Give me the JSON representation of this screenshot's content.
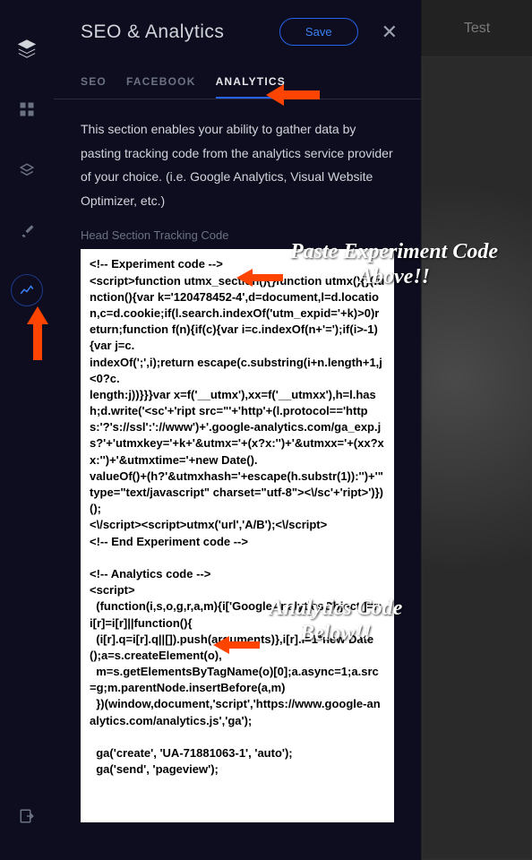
{
  "header": {
    "title": "SEO & Analytics",
    "save_label": "Save"
  },
  "tabs": {
    "seo": "SEO",
    "facebook": "FACEBOOK",
    "analytics": "ANALYTICS"
  },
  "content": {
    "description": "This section enables your ability to gather data by pasting tracking code from the analytics service provider of your choice. (i.e. Google Analytics, Visual Website Optimizer, etc.)",
    "field_label": "Head Section Tracking Code",
    "code": "<!-- Experiment code -->\n<script>function utmx_section(){}function utmx(){}(function(){var k='120478452-4',d=document,l=d.location,c=d.cookie;if(l.search.indexOf('utm_expid='+k)>0)return;function f(n){if(c){var i=c.indexOf(n+'=');if(i>-1){var j=c.\nindexOf(';',i);return escape(c.substring(i+n.length+1,j<0?c.\nlength:j))}}}var x=f('__utmx'),xx=f('__utmxx'),h=l.hash;d.write('<sc'+'ript src=\"'+'http'+(l.protocol=='https:'?'s://ssl':'://www')+'.google-analytics.com/ga_exp.js?'+'utmxkey='+k+'&utmx='+(x?x:'')+'&utmxx='+(xx?xx:'')+'&utmxtime='+new Date().\nvalueOf()+(h?'&utmxhash='+escape(h.substr(1)):'')+'\" type=\"text/javascript\" charset=\"utf-8\"><\\/sc'+'ript>')})();\n<\\/script><script>utmx('url','A/B');<\\/script>\n<!-- End Experiment code -->\n\n<!-- Analytics code -->\n<script>\n  (function(i,s,o,g,r,a,m){i['GoogleAnalyticsObject']=r;i[r]=i[r]||function(){\n  (i[r].q=i[r].q||[]).push(arguments)},i[r].l=1*new Date();a=s.createElement(o),\n  m=s.getElementsByTagName(o)[0];a.async=1;a.src=g;m.parentNode.insertBefore(a,m)\n  })(window,document,'script','https://www.google-analytics.com/analytics.js','ga');\n\n  ga('create', 'UA-71881063-1', 'auto');\n  ga('send', 'pageview');"
  },
  "right": {
    "test_label": "Test"
  },
  "annotations": {
    "paste_above": "Paste Experiment Code Above!!",
    "paste_below": "Analytics Code Below!!"
  }
}
